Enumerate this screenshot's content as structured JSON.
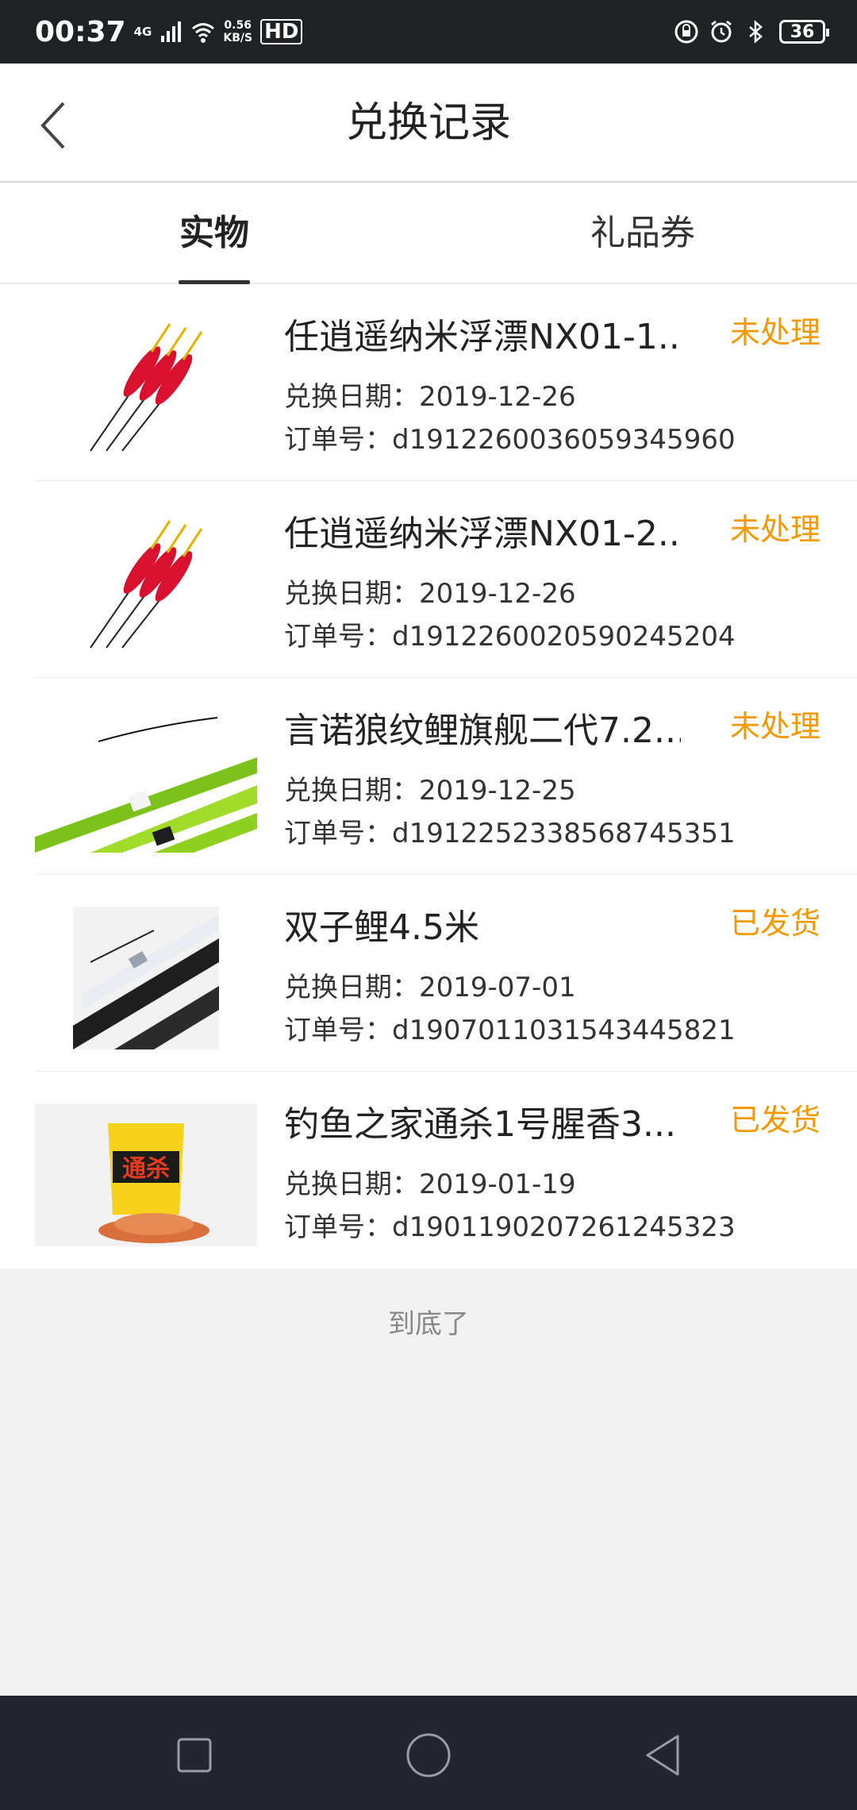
{
  "status_bar": {
    "time": "00:37",
    "network": "4G",
    "speed_value": "0.56",
    "speed_unit": "KB/S",
    "hd": "HD",
    "battery": "36"
  },
  "header": {
    "title": "兑换记录"
  },
  "tabs": [
    {
      "label": "实物",
      "active": true
    },
    {
      "label": "礼品券",
      "active": false
    }
  ],
  "items": [
    {
      "title": "任逍遥纳米浮漂NX01-1...",
      "status": "未处理",
      "date": "兑换日期：2019-12-26",
      "order": "订单号：d1912260036059345960",
      "thumb": "float-icon"
    },
    {
      "title": "任逍遥纳米浮漂NX01-2...",
      "status": "未处理",
      "date": "兑换日期：2019-12-26",
      "order": "订单号：d1912260020590245204",
      "thumb": "float-icon"
    },
    {
      "title": "言诺狼纹鲤旗舰二代7.2...",
      "status": "未处理",
      "date": "兑换日期：2019-12-25",
      "order": "订单号：d1912252338568745351",
      "thumb": "rod-green-icon"
    },
    {
      "title": "双子鲤4.5米",
      "status": "已发货",
      "date": "兑换日期：2019-07-01",
      "order": "订单号：d1907011031543445821",
      "thumb": "rod-black-icon"
    },
    {
      "title": "钓鱼之家通杀1号腥香3...",
      "status": "已发货",
      "date": "兑换日期：2019-01-19",
      "order": "订单号：d1901190207261245323",
      "thumb": "bait-bag-icon",
      "thumb_text": "通杀"
    }
  ],
  "end_text": "到底了",
  "colors": {
    "status": "#f39800",
    "statusbar": "#202124",
    "navbar": "#23252f"
  }
}
